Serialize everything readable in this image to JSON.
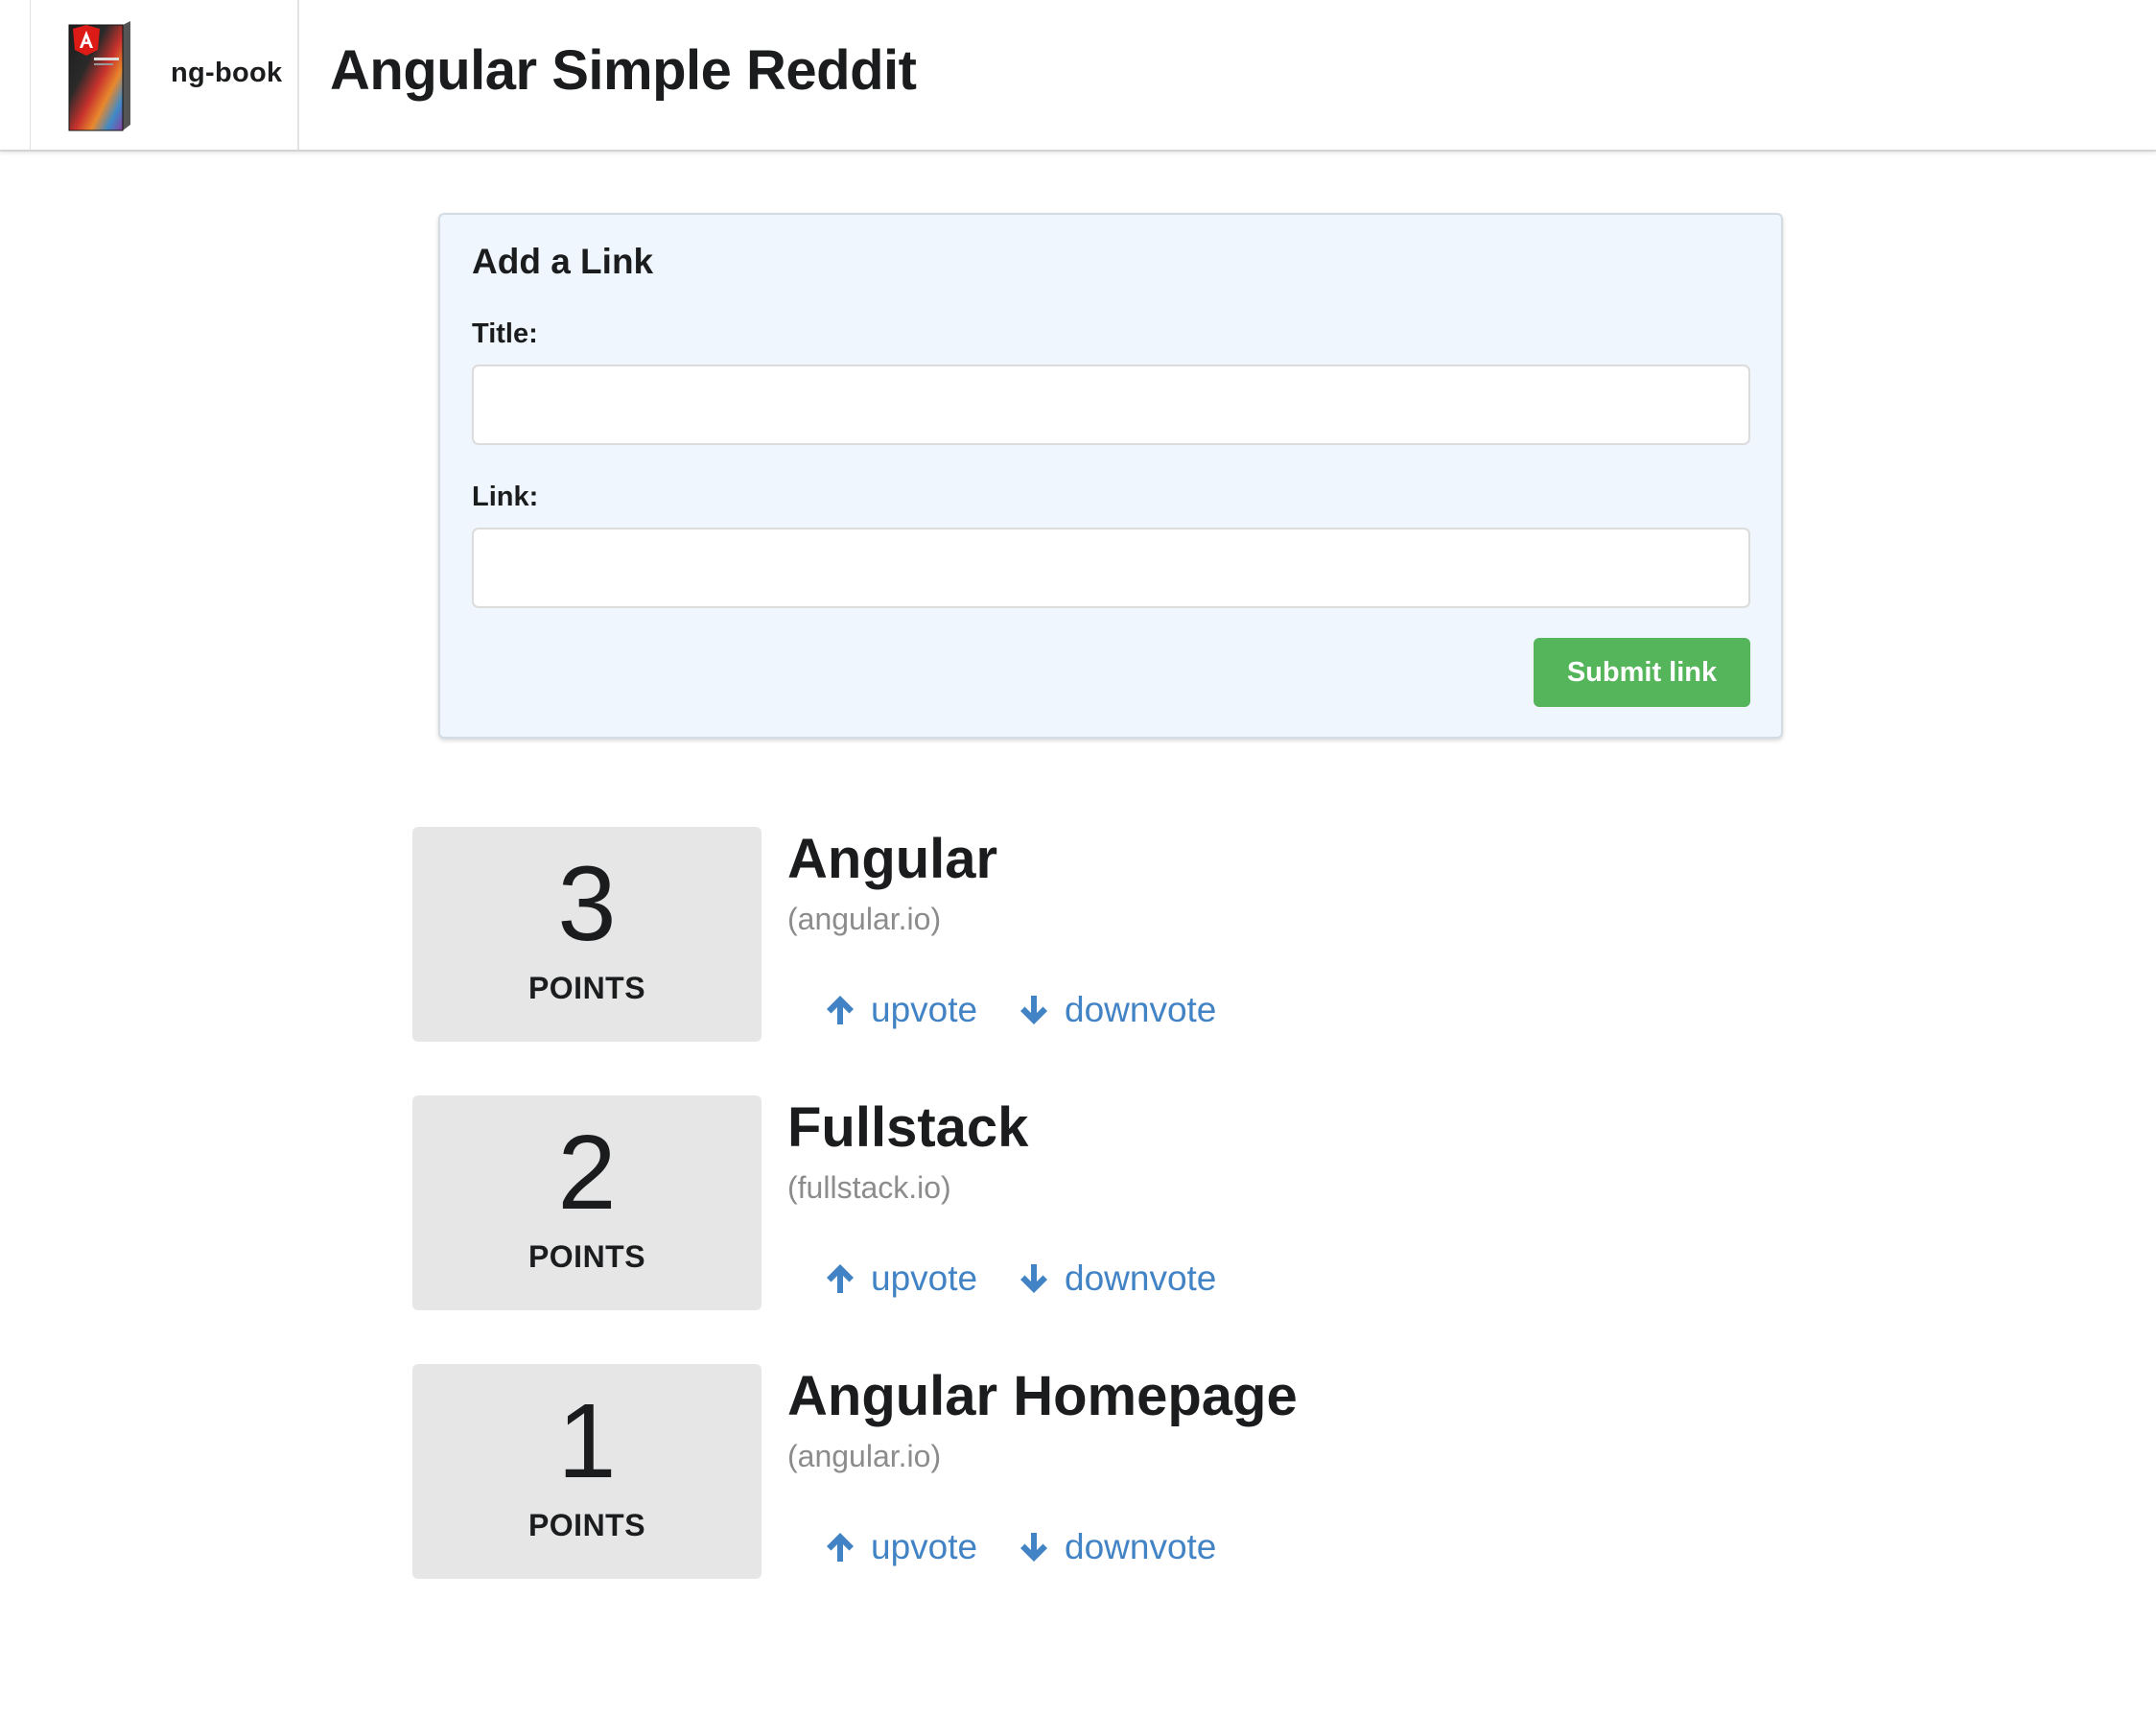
{
  "header": {
    "brand_name": "ng-book",
    "app_title": "Angular Simple Reddit"
  },
  "form": {
    "heading": "Add a Link",
    "title_label": "Title:",
    "title_value": "",
    "link_label": "Link:",
    "link_value": "",
    "submit_label": "Submit link"
  },
  "articles": [
    {
      "votes": "3",
      "votes_label": "POINTS",
      "title": "Angular",
      "domain": "(angular.io)",
      "upvote_label": "upvote",
      "downvote_label": "downvote"
    },
    {
      "votes": "2",
      "votes_label": "POINTS",
      "title": "Fullstack",
      "domain": "(fullstack.io)",
      "upvote_label": "upvote",
      "downvote_label": "downvote"
    },
    {
      "votes": "1",
      "votes_label": "POINTS",
      "title": "Angular Homepage",
      "domain": "(angular.io)",
      "upvote_label": "upvote",
      "downvote_label": "downvote"
    }
  ],
  "icons": {
    "logo": "ng-book-cover-icon",
    "upvote": "arrow-up-icon",
    "downvote": "arrow-down-icon"
  },
  "colors": {
    "link": "#4183c4",
    "submit": "#55b55a",
    "form_background": "#eff6fd",
    "votes_background": "#e6e6e6",
    "domain_text": "#8c8c8c"
  }
}
